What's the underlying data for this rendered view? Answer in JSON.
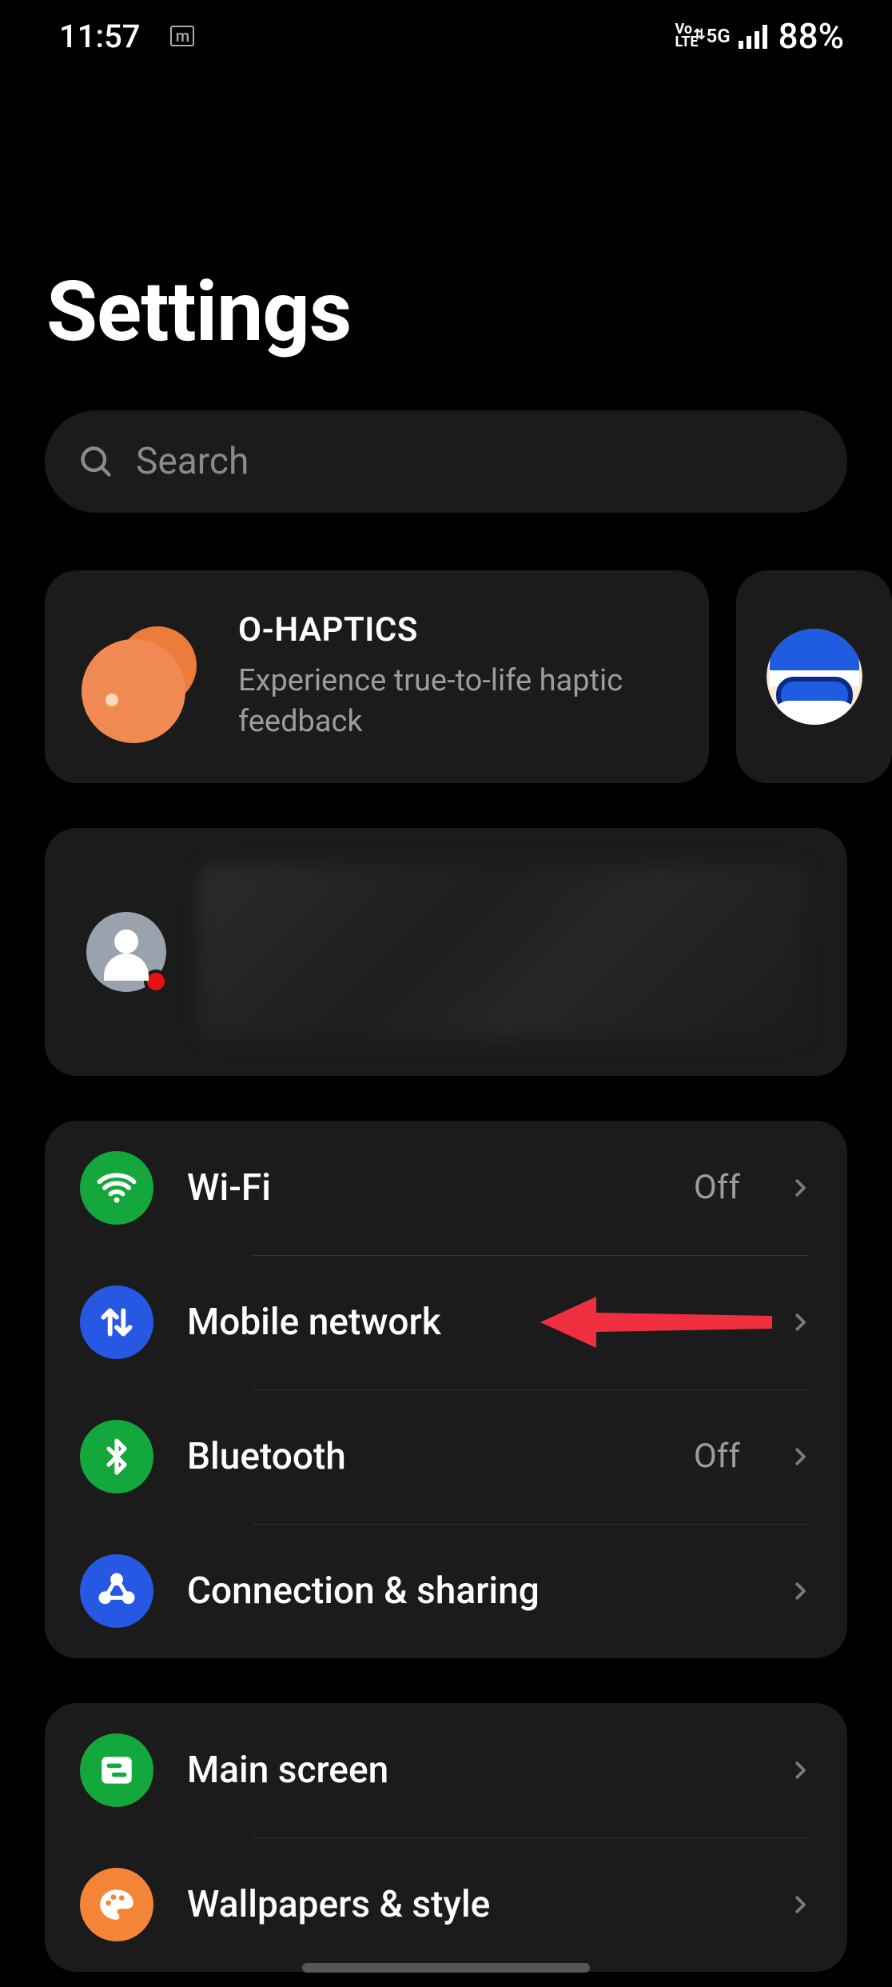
{
  "status_bar": {
    "time": "11:57",
    "app_indicator": "m",
    "volte": "Vo\nLTE",
    "network_type": "5G",
    "battery_text": "88%"
  },
  "page_title": "Settings",
  "search": {
    "placeholder": "Search"
  },
  "promo": {
    "title": "O-HAPTICS",
    "subtitle": "Experience true-to-life haptic feedback"
  },
  "groups": [
    {
      "rows": [
        {
          "id": "wifi",
          "label": "Wi-Fi",
          "status": "Off",
          "icon": "wifi",
          "icon_color": "green"
        },
        {
          "id": "mobile",
          "label": "Mobile network",
          "status": "",
          "icon": "updown",
          "icon_color": "blue",
          "highlighted": true
        },
        {
          "id": "bluetooth",
          "label": "Bluetooth",
          "status": "Off",
          "icon": "bt",
          "icon_color": "green"
        },
        {
          "id": "connshare",
          "label": "Connection & sharing",
          "status": "",
          "icon": "share",
          "icon_color": "blue"
        }
      ]
    },
    {
      "rows": [
        {
          "id": "mainscreen",
          "label": "Main screen",
          "status": "",
          "icon": "sliders",
          "icon_color": "green"
        },
        {
          "id": "wallpapers",
          "label": "Wallpapers & style",
          "status": "",
          "icon": "palette",
          "icon_color": "orange"
        }
      ]
    }
  ],
  "colors": {
    "green": "#14a73c",
    "blue": "#2658e4",
    "orange": "#f48536",
    "arrow": "#ef2f3d"
  }
}
